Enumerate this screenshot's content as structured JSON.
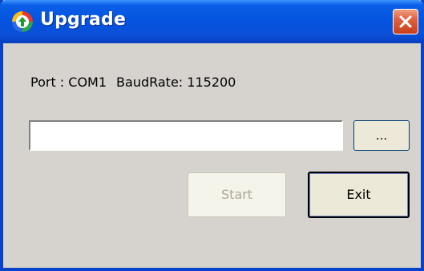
{
  "window": {
    "title": "Upgrade",
    "icon": "upgrade-app-icon",
    "close_icon": "close-icon"
  },
  "info": {
    "port_text": "Port : COM1",
    "baud_text": "BaudRate: 115200"
  },
  "file_path": {
    "value": "",
    "placeholder": ""
  },
  "buttons": {
    "browse_label": "...",
    "start_label": "Start",
    "start_enabled": false,
    "exit_label": "Exit"
  },
  "colors": {
    "titlebar": "#0454e0",
    "window_bg": "#d6d3ce",
    "close_button": "#e06040",
    "disabled_text": "#aca899"
  }
}
